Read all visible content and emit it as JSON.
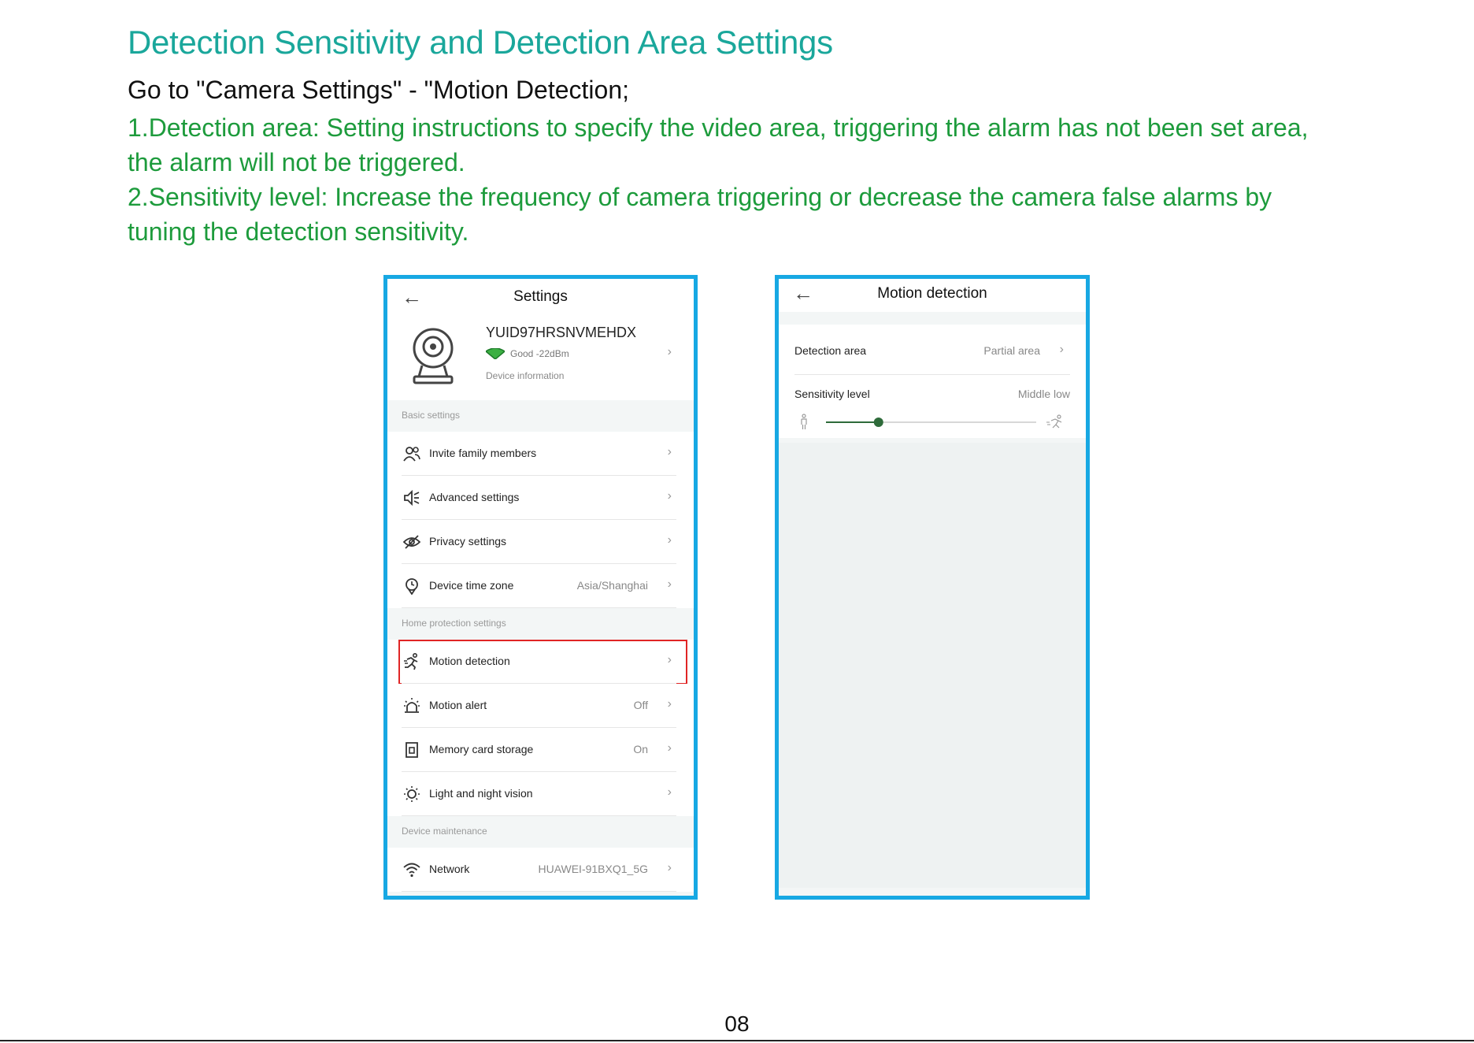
{
  "heading": "Detection Sensitivity and Detection Area Settings",
  "intro": "Go to \"Camera Settings\" - \"Motion Detection;",
  "paragraph1_line1": "1.Detection area: Setting instructions to specify the video area, triggering the alarm has not been set area,",
  "paragraph1_line2": "the alarm will not be triggered.",
  "paragraph2_line1": "2.Sensitivity level: Increase the frequency of camera triggering or decrease the camera false alarms by",
  "paragraph2_line2": "tuning the detection sensitivity.",
  "settings_screen": {
    "back_icon": "back-arrow-icon",
    "title": "Settings",
    "device": {
      "id": "YUID97HRSNVMEHDX",
      "signal": "Good -22dBm",
      "info_label": "Device information",
      "camera_icon": "camera-icon",
      "wifi_icon": "wifi-signal-icon",
      "wifi_color": "#3cb043"
    },
    "sections": {
      "basic": "Basic settings",
      "home": "Home protection settings",
      "maintenance": "Device maintenance"
    },
    "items": [
      {
        "label": "Invite family members",
        "value": "",
        "icon": "family-members-icon"
      },
      {
        "label": "Advanced settings",
        "value": "",
        "icon": "speaker-icon"
      },
      {
        "label": "Privacy settings",
        "value": "",
        "icon": "hidden-eye-icon"
      },
      {
        "label": "Device time zone",
        "value": "Asia/Shanghai",
        "icon": "location-clock-icon"
      },
      {
        "label": "Motion detection",
        "value": "",
        "icon": "running-person-icon"
      },
      {
        "label": "Motion alert",
        "value": "Off",
        "icon": "alarm-siren-icon"
      },
      {
        "label": "Memory card storage",
        "value": "On",
        "icon": "sd-card-icon"
      },
      {
        "label": "Light and night vision",
        "value": "",
        "icon": "light-moon-icon"
      },
      {
        "label": "Network",
        "value": "HUAWEI-91BXQ1_5G",
        "icon": "wifi-icon"
      }
    ],
    "highlight_color": "#e02525"
  },
  "motion_screen": {
    "back_icon": "back-arrow-icon",
    "title": "Motion detection",
    "detection_area_label": "Detection area",
    "detection_area_value": "Partial area",
    "sensitivity_label": "Sensitivity level",
    "sensitivity_value": "Middle low",
    "slider_fraction": 0.25,
    "slider_color": "#2e6b3a"
  },
  "frame_color": "#17a8e3",
  "page_number": "08"
}
